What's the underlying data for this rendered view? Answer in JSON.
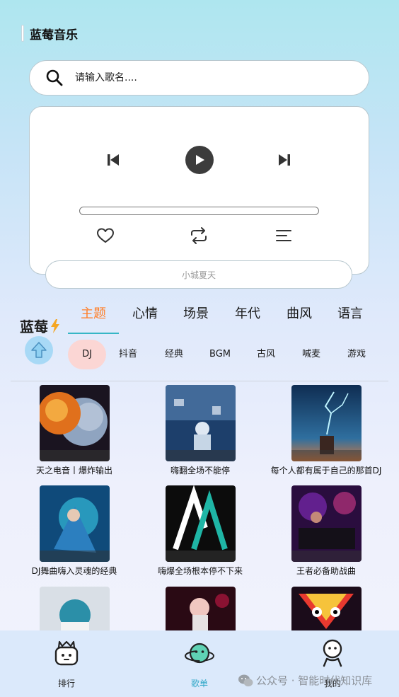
{
  "app": {
    "title": "蓝莓音乐"
  },
  "search": {
    "placeholder": "请输入歌名...."
  },
  "player": {
    "current_song": "小城夏天",
    "progress": 0.0
  },
  "brand": {
    "text": "蓝莓"
  },
  "tabs": [
    {
      "label": "主题",
      "active": true
    },
    {
      "label": "心情",
      "active": false
    },
    {
      "label": "场景",
      "active": false
    },
    {
      "label": "年代",
      "active": false
    },
    {
      "label": "曲风",
      "active": false
    },
    {
      "label": "语言",
      "active": false
    }
  ],
  "chips": [
    {
      "label": "DJ",
      "active": true
    },
    {
      "label": "抖音",
      "active": false
    },
    {
      "label": "经典",
      "active": false
    },
    {
      "label": "BGM",
      "active": false
    },
    {
      "label": "古风",
      "active": false
    },
    {
      "label": "喊麦",
      "active": false
    },
    {
      "label": "游戏",
      "active": false
    }
  ],
  "playlists": [
    {
      "title": "天之电音丨爆炸输出"
    },
    {
      "title": "嗨翻全场不能停"
    },
    {
      "title": "每个人都有属于自己的那首DJ"
    },
    {
      "title": "DJ舞曲嗨入灵魂的经典"
    },
    {
      "title": "嗨爆全场根本停不下来"
    },
    {
      "title": "王者必备助战曲"
    },
    {
      "title": ""
    },
    {
      "title": ""
    },
    {
      "title": ""
    }
  ],
  "bottom_nav": [
    {
      "label": "排行",
      "icon": "robot-icon",
      "active": false
    },
    {
      "label": "歌单",
      "icon": "planet-icon",
      "active": true
    },
    {
      "label": "我的",
      "icon": "person-icon",
      "active": false
    }
  ],
  "watermark": {
    "text": "公众号 · 智能时代知识库"
  },
  "colors": {
    "accent_orange": "#ff7f2a",
    "accent_teal": "#36b6c6",
    "chip_active_bg": "#fbd6d4",
    "nav_active": "#31a8c8"
  }
}
